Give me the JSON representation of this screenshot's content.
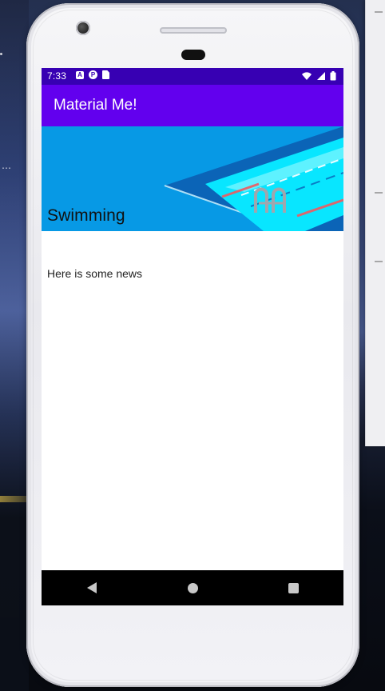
{
  "device": {
    "status_bar": {
      "time": "7:33",
      "notification_icons": [
        "a-icon",
        "p-icon",
        "sd-card-icon"
      ],
      "system_icons": [
        "wifi-icon",
        "cellular-signal-icon",
        "battery-icon"
      ]
    },
    "nav_bar": {
      "buttons": [
        "back-button",
        "home-button",
        "recents-button"
      ]
    }
  },
  "app": {
    "title": "Material Me!",
    "card": {
      "title": "Swimming",
      "body": "Here is some news"
    }
  },
  "colors": {
    "status_bar": "#3700b3",
    "app_bar": "#6200ee",
    "hero_background": "#0799e5",
    "pool_deck": "#0b64b7",
    "pool_water": "#08e6ff",
    "lane_line": "#f05a60",
    "nav_bar": "#000000"
  }
}
